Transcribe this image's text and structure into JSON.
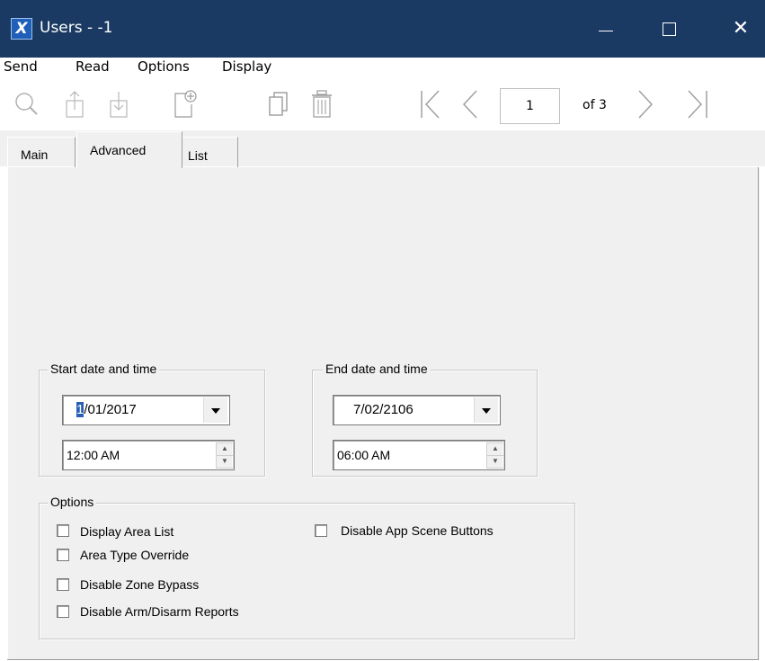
{
  "window": {
    "title": "Users - -1",
    "app_icon_glyph": "X",
    "minimize_glyph": "—",
    "close_glyph": "✕"
  },
  "menu": [
    "Send",
    "Read",
    "Options",
    "Display"
  ],
  "toolbar": {
    "icons": [
      "search-icon",
      "upload-icon",
      "download-icon",
      "new-record-icon",
      "copy-icon",
      "delete-icon",
      "first-record-icon",
      "previous-record-icon",
      "next-record-icon",
      "last-record-icon"
    ],
    "page_current": "1",
    "page_total_label": "of 3"
  },
  "tabs": [
    "Main",
    "Advanced",
    "List"
  ],
  "active_tab": "Advanced",
  "start": {
    "legend": "Start date and time",
    "date_selected": "1",
    "date_rest": "/01/2017",
    "time": "12:00 AM"
  },
  "end": {
    "legend": "End date and time",
    "date": "7/02/2106",
    "time": "06:00 AM"
  },
  "options": {
    "legend": "Options",
    "items": [
      {
        "label": "Display Area List",
        "checked": false
      },
      {
        "label": "Area Type Override",
        "checked": false
      },
      {
        "label": "Disable Zone Bypass",
        "checked": false
      },
      {
        "label": "Disable Arm/Disarm Reports",
        "checked": false
      },
      {
        "label": "Disable App Scene Buttons",
        "checked": false
      }
    ]
  },
  "colors": {
    "titlebar": "#1a3a63",
    "panel": "#f0f0f0",
    "selection": "#2a5fb7"
  }
}
